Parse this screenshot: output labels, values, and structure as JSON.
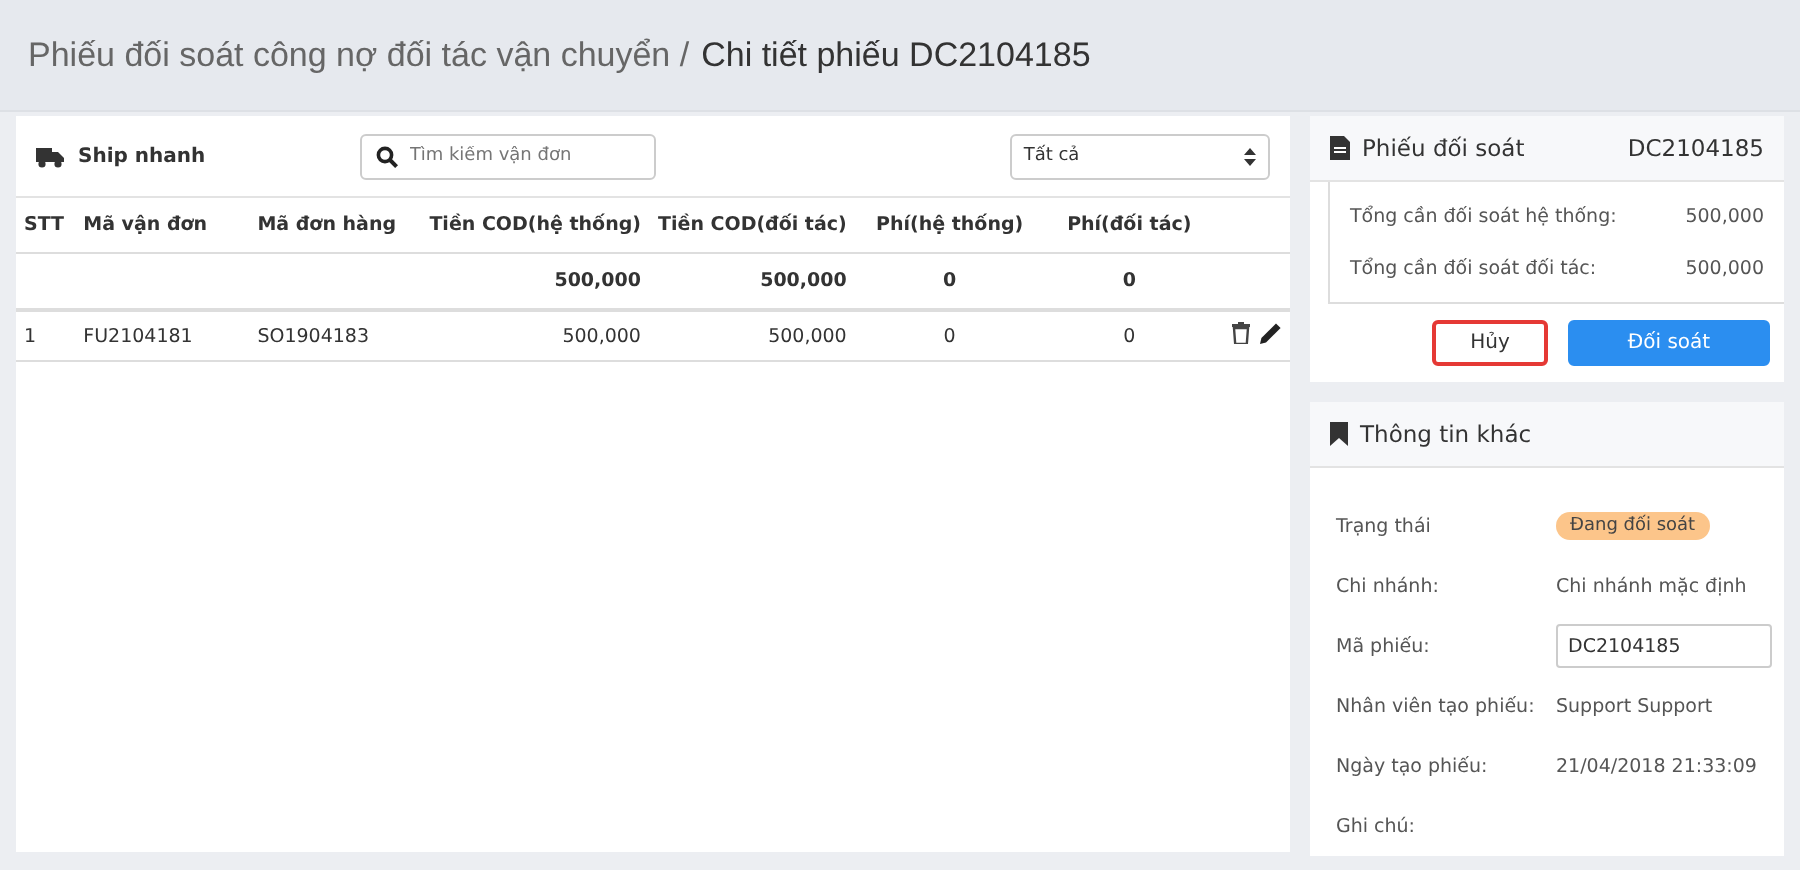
{
  "breadcrumb": {
    "parent": "Phiếu đối soát công nợ đối tác vận chuyển /",
    "current": "Chi tiết phiếu DC2104185"
  },
  "left": {
    "carrier": "Ship nhanh",
    "search": {
      "placeholder": "Tìm kiếm vận đơn"
    },
    "filter": {
      "value": "Tất cả"
    },
    "table": {
      "columns": [
        "STT",
        "Mã vận đơn",
        "Mã đơn hàng",
        "Tiền COD(hệ thống)",
        "Tiền COD(đối tác)",
        "Phí(hệ thống)",
        "Phí(đối tác)"
      ],
      "totals": [
        "500,000",
        "500,000",
        "0",
        "0"
      ],
      "rows": [
        {
          "cells": [
            "1",
            "FU2104181",
            "SO1904183",
            "500,000",
            "500,000",
            "0",
            "0"
          ]
        }
      ]
    }
  },
  "voucher": {
    "title": "Phiếu đối soát",
    "code": "DC2104185",
    "lines": [
      {
        "label": "Tổng cần đối soát hệ thống:",
        "value": "500,000"
      },
      {
        "label": "Tổng cần đối soát đối tác:",
        "value": "500,000"
      }
    ],
    "buttons": [
      {
        "label": "Hủy",
        "kind": "secondary",
        "highlighted": true
      },
      {
        "label": "Đối soát",
        "kind": "primary",
        "highlighted": false
      }
    ]
  },
  "info": {
    "title": "Thông tin khác",
    "fields": [
      {
        "label": "Trạng thái",
        "kind": "badge",
        "value": "Đang đối soát"
      },
      {
        "label": "Chi nhánh:",
        "kind": "text",
        "value": "Chi nhánh mặc định"
      },
      {
        "label": "Mã phiếu:",
        "kind": "input",
        "value": "DC2104185"
      },
      {
        "label": "Nhân viên tạo phiếu:",
        "kind": "text",
        "value": "Support Support"
      },
      {
        "label": "Ngày tạo phiếu:",
        "kind": "text",
        "value": "21/04/2018 21:33:09"
      },
      {
        "label": "Ghi chú:",
        "kind": "text"
      }
    ]
  }
}
